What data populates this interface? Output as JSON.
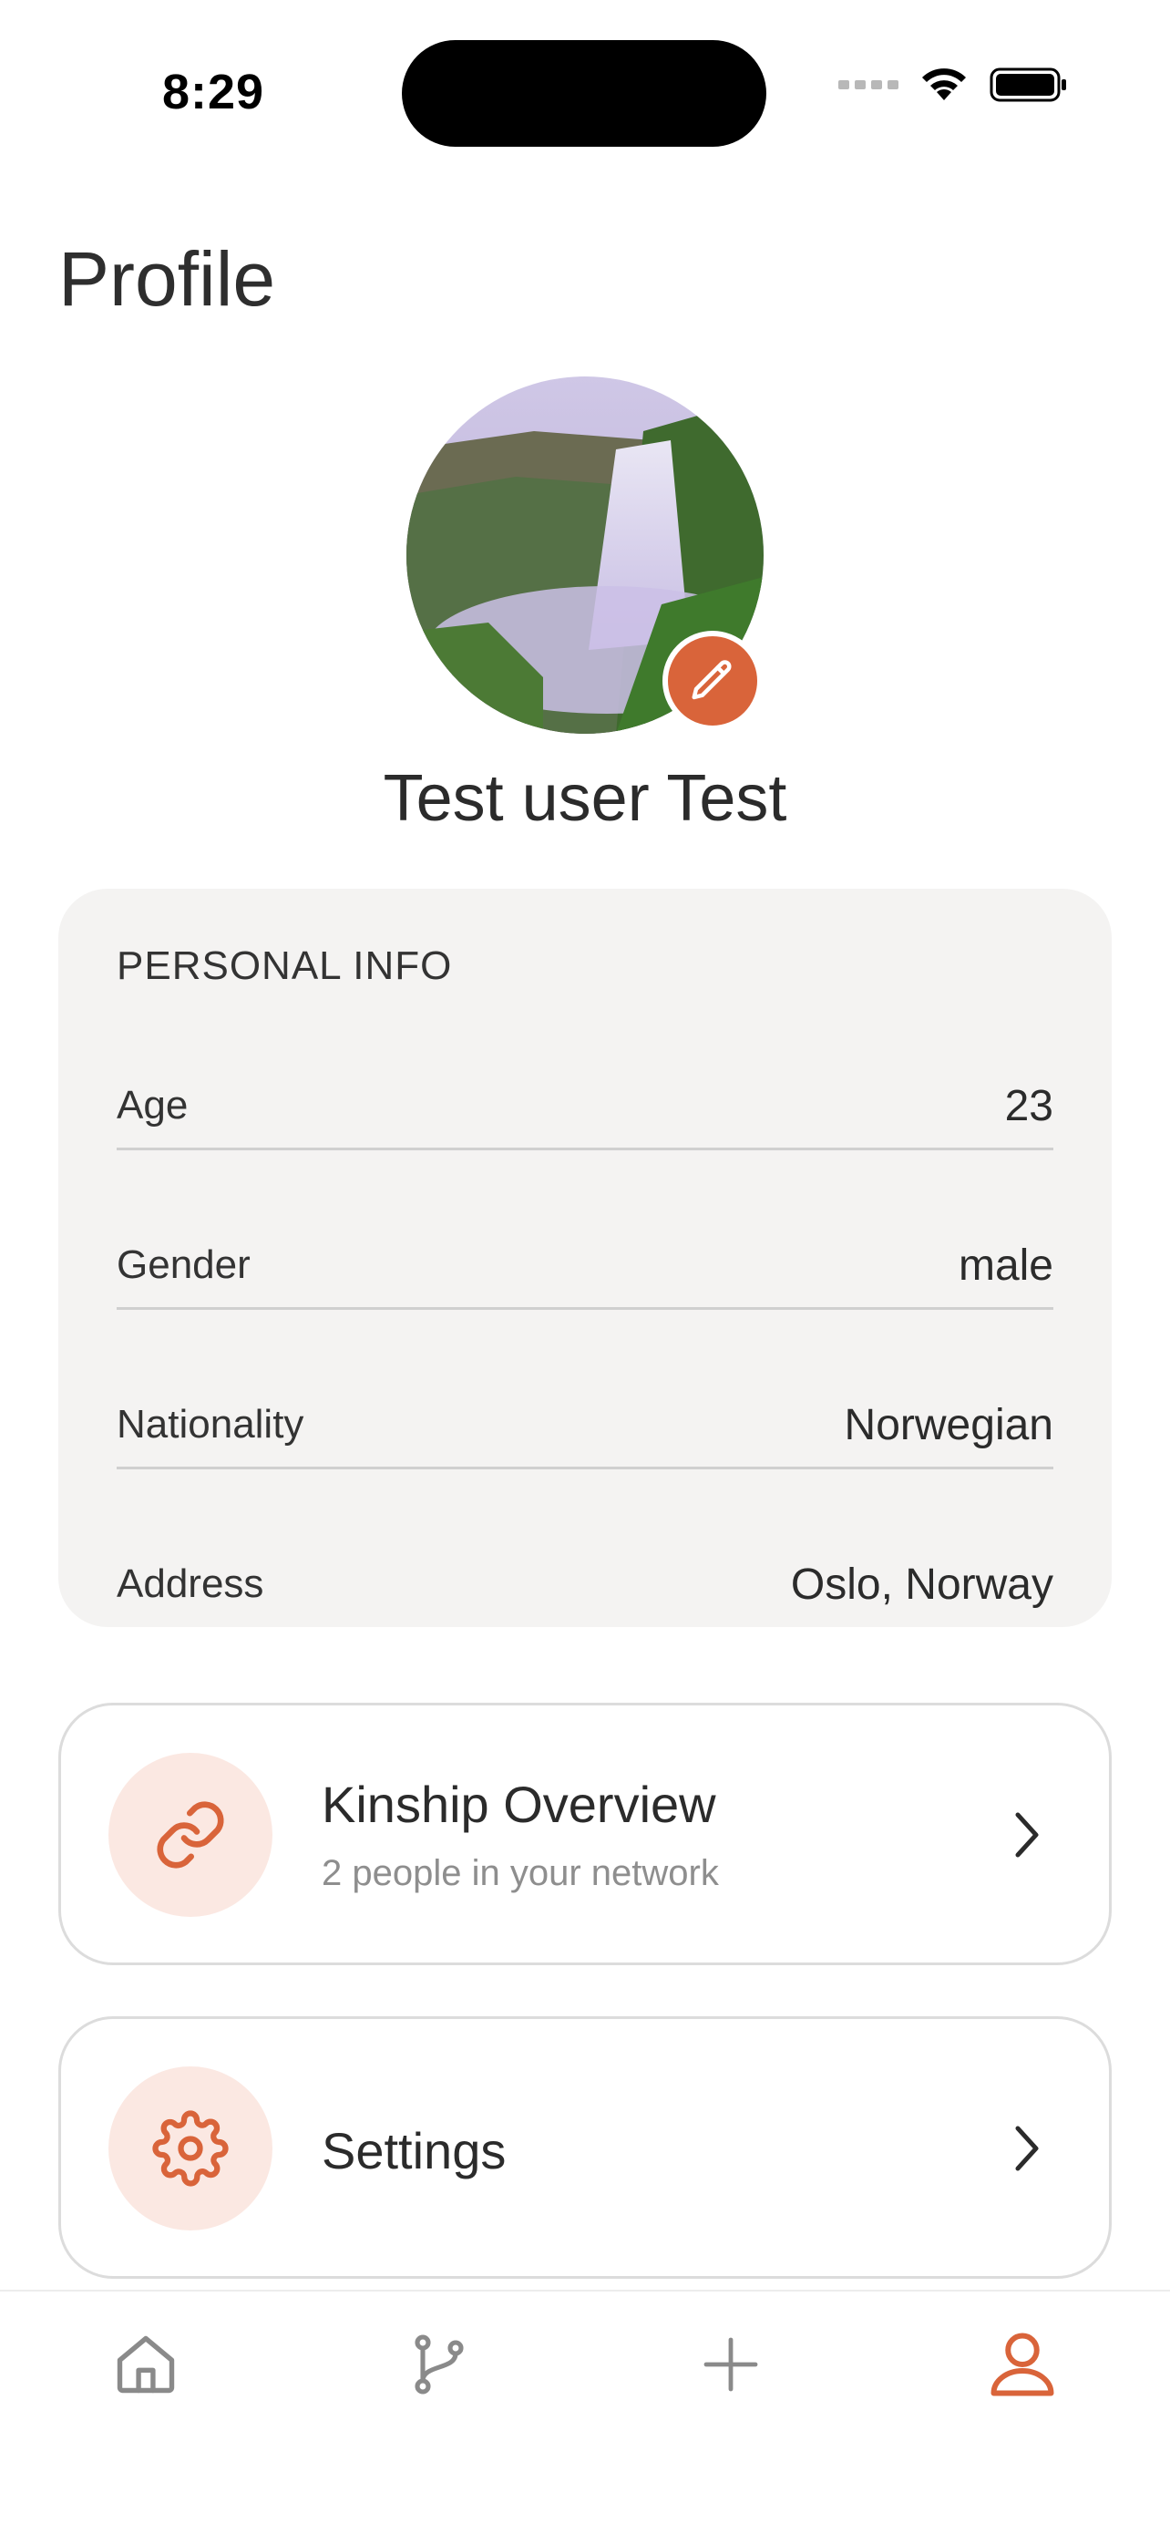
{
  "status_bar": {
    "time": "8:29"
  },
  "page": {
    "title": "Profile"
  },
  "profile": {
    "name": "Test user Test"
  },
  "personal_info": {
    "heading": "PERSONAL INFO",
    "rows": [
      {
        "label": "Age",
        "value": "23"
      },
      {
        "label": "Gender",
        "value": "male"
      },
      {
        "label": "Nationality",
        "value": "Norwegian"
      },
      {
        "label": "Address",
        "value": "Oslo, Norway"
      }
    ]
  },
  "nav_cards": [
    {
      "title": "Kinship Overview",
      "subtitle": "2 people in your network",
      "icon": "link-icon"
    },
    {
      "title": "Settings",
      "icon": "gear-icon"
    }
  ],
  "tab_bar": {
    "tabs": [
      {
        "icon": "home-icon",
        "active": false
      },
      {
        "icon": "branch-icon",
        "active": false
      },
      {
        "icon": "plus-icon",
        "active": false
      },
      {
        "icon": "person-icon",
        "active": true
      }
    ]
  },
  "colors": {
    "accent": "#d9643a",
    "accent_soft": "#fbe8e2",
    "card_bg": "#f4f3f2",
    "inactive_icon": "#8a8a8a"
  }
}
